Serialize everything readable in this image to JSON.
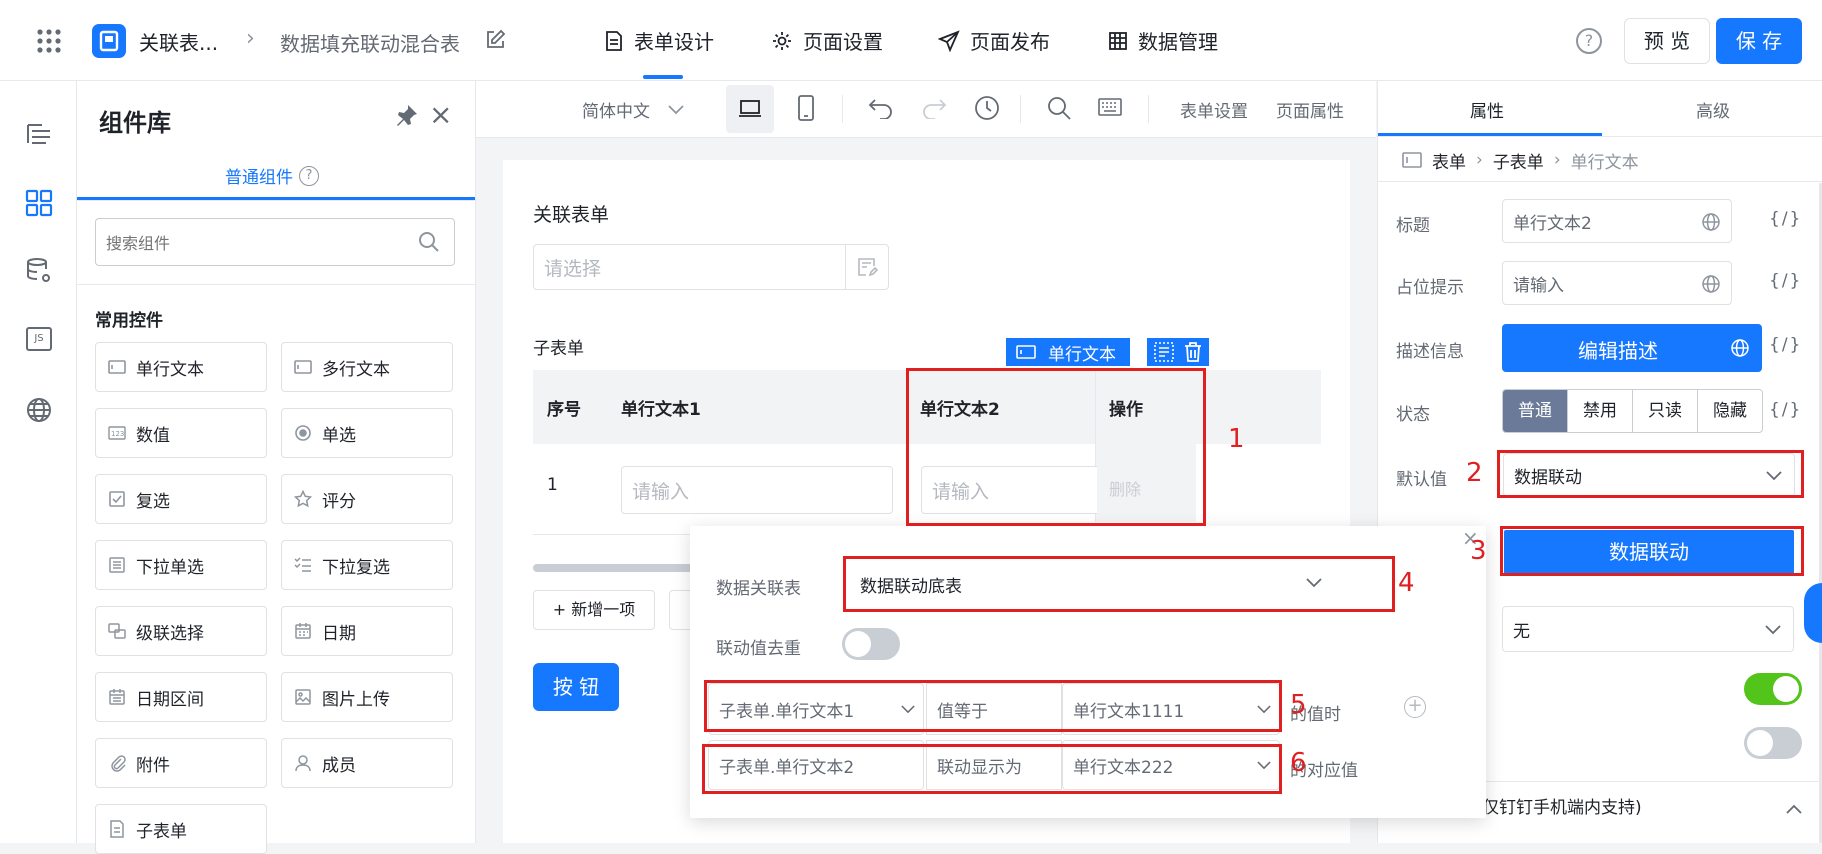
{
  "topbar": {
    "app_name": "关联表...",
    "form_name": "数据填充联动混合表",
    "tabs": [
      {
        "label": "表单设计",
        "active": true
      },
      {
        "label": "页面设置"
      },
      {
        "label": "页面发布"
      },
      {
        "label": "数据管理"
      }
    ],
    "preview_label": "预 览",
    "save_label": "保 存",
    "help_glyph": "?"
  },
  "component_lib": {
    "title": "组件库",
    "tab_label": "普通组件",
    "search_placeholder": "搜索组件",
    "section_title": "常用控件",
    "items": [
      "单行文本",
      "多行文本",
      "数值",
      "单选",
      "复选",
      "评分",
      "下拉单选",
      "下拉复选",
      "级联选择",
      "日期",
      "日期区间",
      "图片上传",
      "附件",
      "成员",
      "子表单"
    ]
  },
  "center_toolbar": {
    "language": "简体中文",
    "form_settings": "表单设置",
    "page_props": "页面属性"
  },
  "canvas": {
    "assoc_label": "关联表单",
    "assoc_placeholder": "请选择",
    "subform_label": "子表单",
    "selected_tag": "单行文本",
    "columns": [
      "序号",
      "单行文本1",
      "单行文本2",
      "操作"
    ],
    "row_index": "1",
    "row_placeholder1": "请输入",
    "row_placeholder2": "请输入",
    "row_delete": "删除",
    "add_item": "+ 新增一项",
    "button_label": "按 钮"
  },
  "right_panel": {
    "tabs": [
      "属性",
      "高级"
    ],
    "breadcrumb": [
      "表单",
      "子表单",
      "单行文本"
    ],
    "title_label": "标题",
    "title_value": "单行文本2",
    "placeholder_label": "占位提示",
    "placeholder_value": "请输入",
    "desc_label": "描述信息",
    "desc_button": "编辑描述",
    "state_label": "状态",
    "states": [
      "普通",
      "禁用",
      "只读",
      "隐藏"
    ],
    "default_label": "默认值",
    "default_value": "数据联动",
    "linkage_button": "数据联动",
    "select_none": "无",
    "curly": "{/}",
    "footer_text": "仅钉钉手机端内支持)"
  },
  "popup": {
    "table_label": "数据关联表",
    "table_value": "数据联动底表",
    "dedup_label": "联动值去重",
    "cond_field": "子表单.单行文本1",
    "cond_op": "值等于",
    "cond_value": "单行文本1111",
    "cond_suffix": "的值时",
    "map_field": "子表单.单行文本2",
    "map_op": "联动显示为",
    "map_value": "单行文本222",
    "map_suffix": "的对应值"
  },
  "annotations": [
    "1",
    "2",
    "3",
    "4",
    "5",
    "6"
  ],
  "colors": {
    "primary": "#1677ff",
    "annotation": "#e02020",
    "toggle_on": "#52c41a"
  }
}
